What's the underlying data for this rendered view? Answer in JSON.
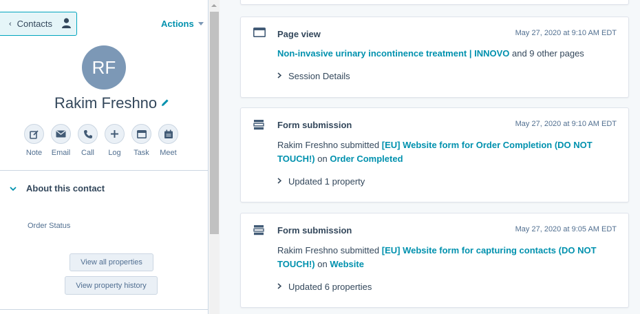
{
  "sidebar": {
    "back_label": "Contacts",
    "actions_label": "Actions",
    "avatar_initials": "RF",
    "contact_name": "Rakim Freshno",
    "quick_actions": [
      {
        "label": "Note",
        "icon": "note-icon"
      },
      {
        "label": "Email",
        "icon": "email-icon"
      },
      {
        "label": "Call",
        "icon": "call-icon"
      },
      {
        "label": "Log",
        "icon": "log-icon"
      },
      {
        "label": "Task",
        "icon": "task-icon"
      },
      {
        "label": "Meet",
        "icon": "meet-icon"
      }
    ],
    "about_section_title": "About this contact",
    "order_status_label": "Order Status",
    "view_all_properties": "View all properties",
    "view_property_history": "View property history"
  },
  "timeline": [
    {
      "type": "Page view",
      "icon": "browser-window-icon",
      "timestamp": "May 27, 2020 at 9:10 AM EDT",
      "link_text": "Non-invasive urinary incontinence treatment | INNOVO",
      "suffix_text": " and 9 other pages",
      "details_label": "Session Details"
    },
    {
      "type": "Form submission",
      "icon": "form-icon",
      "timestamp": "May 27, 2020 at 9:10 AM EDT",
      "prefix_text": "Rakim Freshno submitted ",
      "form_link": "[EU] Website form for Order Completion (DO NOT TOUCH!)",
      "on_text": " on ",
      "page_link": "Order Completed",
      "details_label": "Updated 1 property"
    },
    {
      "type": "Form submission",
      "icon": "form-icon",
      "timestamp": "May 27, 2020 at 9:05 AM EDT",
      "prefix_text": "Rakim Freshno submitted ",
      "form_link": "[EU] Website form for capturing contacts (DO NOT TOUCH!)",
      "on_text": " on ",
      "page_link": "Website",
      "details_label": "Updated 6 properties"
    }
  ],
  "colors": {
    "accent": "#0091ae",
    "text": "#33475b",
    "avatar_bg": "#7c98b6",
    "background": "#f5f8fa"
  }
}
